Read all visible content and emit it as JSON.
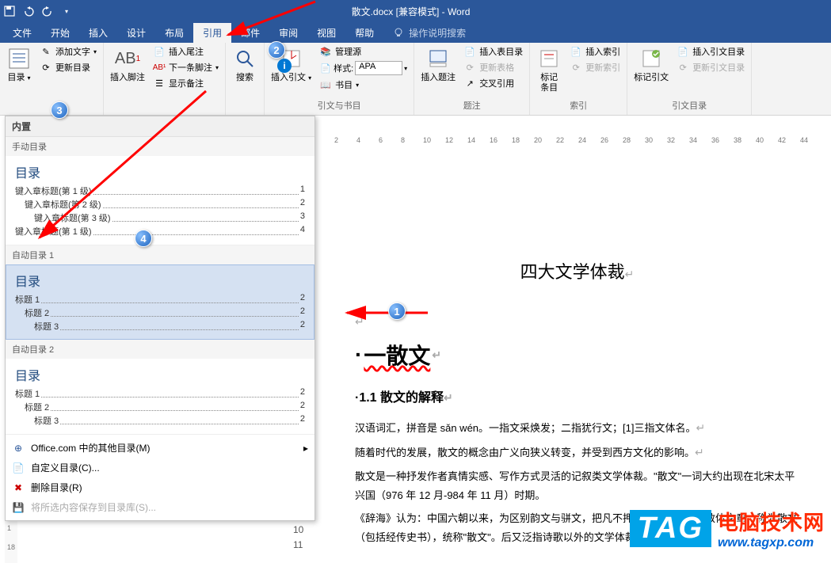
{
  "title": "散文.docx [兼容模式] - Word",
  "qat": {
    "save": "保存",
    "undo": "撤销",
    "redo": "重做"
  },
  "menu": {
    "file": "文件",
    "home": "开始",
    "insert": "插入",
    "design": "设计",
    "layout": "布局",
    "references": "引用",
    "mailings": "邮件",
    "review": "审阅",
    "view": "视图",
    "help": "帮助",
    "tellme": "操作说明搜索"
  },
  "ribbon": {
    "toc": {
      "btn": "目录",
      "addText": "添加文字",
      "update": "更新目录"
    },
    "footnote": {
      "btn": "插入脚注",
      "endnote": "插入尾注",
      "next": "下一条脚注",
      "show": "显示备注"
    },
    "search": {
      "btn": "搜索"
    },
    "citation": {
      "btn": "插入引文",
      "manage": "管理源",
      "style": "样式:",
      "styleVal": "APA",
      "biblio": "书目",
      "group": "引文与书目"
    },
    "caption": {
      "btn": "插入题注",
      "insertTof": "插入表目录",
      "updateTof": "更新表格",
      "crossRef": "交叉引用",
      "group": "题注"
    },
    "index": {
      "btn": "标记\n条目",
      "insert": "插入索引",
      "update": "更新索引",
      "group": "索引"
    },
    "toa": {
      "btn": "标记引文",
      "insert": "插入引文目录",
      "update": "更新引文目录",
      "group": "引文目录"
    }
  },
  "tocPanel": {
    "builtin": "内置",
    "manual": "手动目录",
    "title": "目录",
    "m1": "键入章标题(第 1 级)",
    "m2": "键入章标题(第 2 级)",
    "m3": "键入章标题(第 3 级)",
    "m4": "键入章标题(第 1 级)",
    "p1": "1",
    "p2": "2",
    "p3": "3",
    "p4": "4",
    "auto1": "自动目录 1",
    "auto2": "自动目录 2",
    "h1": "标题 1",
    "h2": "标题 2",
    "h3": "标题 3",
    "pg2": "2",
    "office": "Office.com 中的其他目录(M)",
    "custom": "自定义目录(C)...",
    "remove": "删除目录(R)",
    "save": "将所选内容保存到目录库(S)..."
  },
  "ruler": [
    "2",
    "4",
    "6",
    "8",
    "10",
    "12",
    "14",
    "16",
    "18",
    "20",
    "22",
    "24",
    "26",
    "28",
    "30",
    "32",
    "34",
    "36",
    "38",
    "40",
    "42",
    "44"
  ],
  "doc": {
    "title": "四大文学体裁",
    "h1": "一散文",
    "h2": "1.1 散文的解释",
    "p1": "汉语词汇，拼音是 sǎn wén。一指文采焕发；二指犹行文；[1]三指文体名。",
    "p2": "随着时代的发展，散文的概念由广义向狭义转变，并受到西方文化的影响。",
    "p3": "散文是一种抒发作者真情实感、写作方式灵活的记叙类文学体裁。\"散文\"一词大约出现在北宋太平兴国（976 年 12 月-984 年 11 月）时期。",
    "p4": "《辞海》认为：中国六朝以来，为区别韵文与骈文，把凡不押韵、不重排偶的散体文章，称为散文（包括经传史书），统称\"散文\"。后又泛指诗歌以外的文学体裁。"
  },
  "lineNums": [
    "10",
    "11"
  ],
  "watermark": {
    "tag": "TAG",
    "cn": "电脑技术网",
    "url": "www.tagxp.com"
  }
}
